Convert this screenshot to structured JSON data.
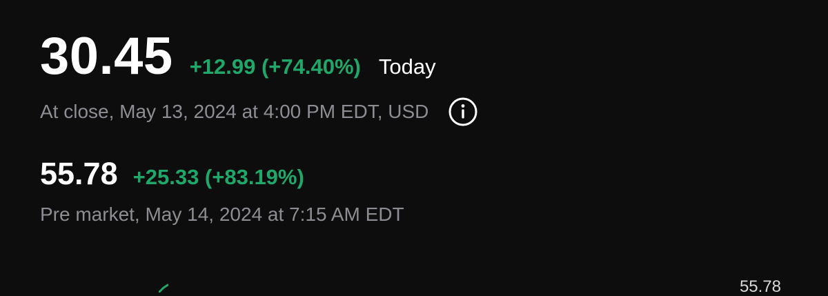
{
  "quote": {
    "close": {
      "price": "30.45",
      "change": "+12.99 (+74.40%)",
      "period": "Today",
      "timestamp": "At close, May 13, 2024 at 4:00 PM EDT, USD",
      "info_icon": "info-circle-icon"
    },
    "premarket": {
      "price": "55.78",
      "change": "+25.33 (+83.19%)",
      "timestamp": "Pre market, May 14, 2024 at 7:15 AM EDT"
    }
  },
  "chart": {
    "last_value_label": "55.78"
  },
  "colors": {
    "background": "#0d0d0d",
    "positive": "#1fa86a",
    "muted_text": "#8d8d93",
    "primary_text": "#ffffff"
  }
}
